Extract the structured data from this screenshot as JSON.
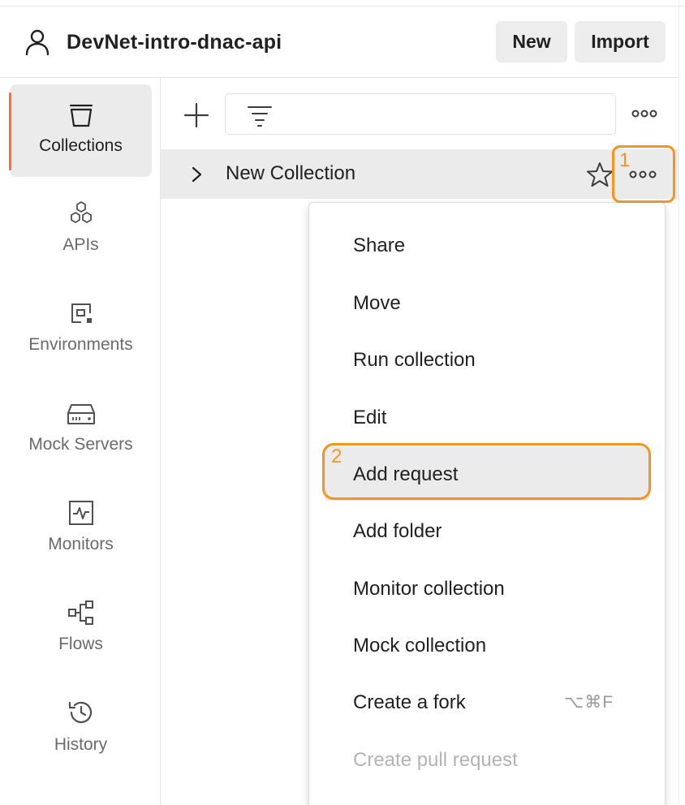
{
  "header": {
    "workspace_icon": "user-icon",
    "workspace_name": "DevNet-intro-dnac-api",
    "new_label": "New",
    "import_label": "Import"
  },
  "sidebar": {
    "items": [
      {
        "label": "Collections",
        "icon": "trash-can-collections-icon",
        "active": true
      },
      {
        "label": "APIs",
        "icon": "hexagons-apis-icon"
      },
      {
        "label": "Environments",
        "icon": "environments-icon"
      },
      {
        "label": "Mock Servers",
        "icon": "server-icon"
      },
      {
        "label": "Monitors",
        "icon": "monitor-pulse-icon"
      },
      {
        "label": "Flows",
        "icon": "flows-icon"
      },
      {
        "label": "History",
        "icon": "history-clock-icon"
      }
    ]
  },
  "collections": {
    "items": [
      {
        "name": "New Collection",
        "expanded": false,
        "starred": false
      }
    ]
  },
  "context_menu": {
    "items": [
      {
        "label": "Share"
      },
      {
        "label": "Move"
      },
      {
        "label": "Run collection"
      },
      {
        "label": "Edit"
      },
      {
        "label": "Add request",
        "hovered": true
      },
      {
        "label": "Add folder"
      },
      {
        "label": "Monitor collection"
      },
      {
        "label": "Mock collection"
      },
      {
        "label": "Create a fork",
        "shortcut": "⌥⌘F"
      },
      {
        "label": "Create pull request",
        "disabled": true
      }
    ]
  },
  "annotations": {
    "step1": "1",
    "step2": "2",
    "color": "#f7931e"
  },
  "colors": {
    "accent": "#ff6c37",
    "highlight": "#f7931e"
  }
}
